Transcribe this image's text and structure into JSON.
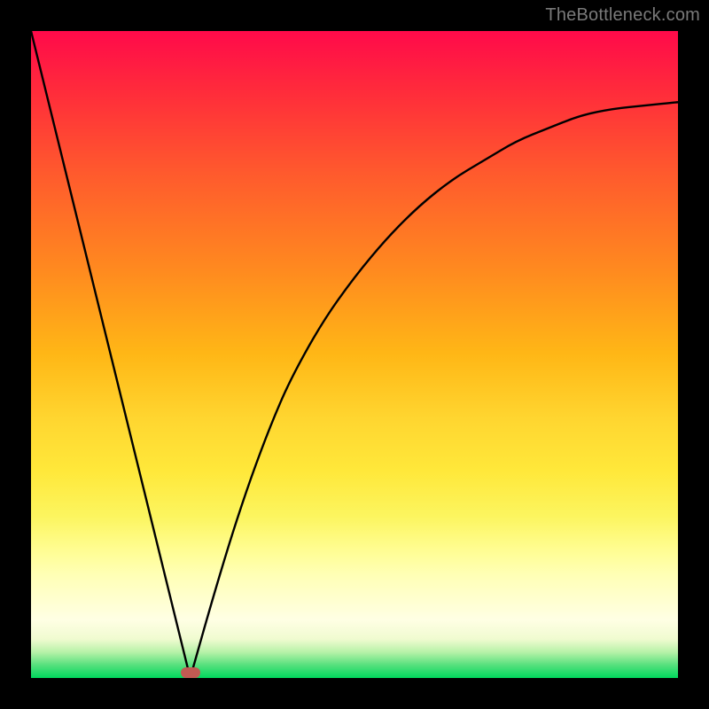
{
  "watermark": "TheBottleneck.com",
  "marker": {
    "color": "#c15a53",
    "cx_frac": 0.246,
    "cy_frac": 0.992
  },
  "chart_data": {
    "type": "line",
    "title": "",
    "xlabel": "",
    "ylabel": "",
    "xlim": [
      0,
      1
    ],
    "ylim": [
      0,
      1
    ],
    "series": [
      {
        "name": "left-segment",
        "x": [
          0.0,
          0.246
        ],
        "y": [
          1.0,
          0.0
        ]
      },
      {
        "name": "right-curve",
        "x": [
          0.246,
          0.28,
          0.31,
          0.34,
          0.37,
          0.4,
          0.45,
          0.5,
          0.55,
          0.6,
          0.65,
          0.7,
          0.75,
          0.8,
          0.85,
          0.9,
          0.95,
          1.0
        ],
        "y": [
          0.0,
          0.12,
          0.22,
          0.31,
          0.39,
          0.46,
          0.55,
          0.62,
          0.68,
          0.73,
          0.77,
          0.8,
          0.83,
          0.85,
          0.87,
          0.88,
          0.885,
          0.89
        ]
      }
    ],
    "annotations": [
      {
        "type": "marker",
        "x": 0.246,
        "y": 0.0,
        "shape": "pill",
        "color": "#c15a53"
      }
    ],
    "background_gradient": {
      "top": "#ff0a4a",
      "mid": "#ffd630",
      "bottom": "#00d85d"
    }
  }
}
